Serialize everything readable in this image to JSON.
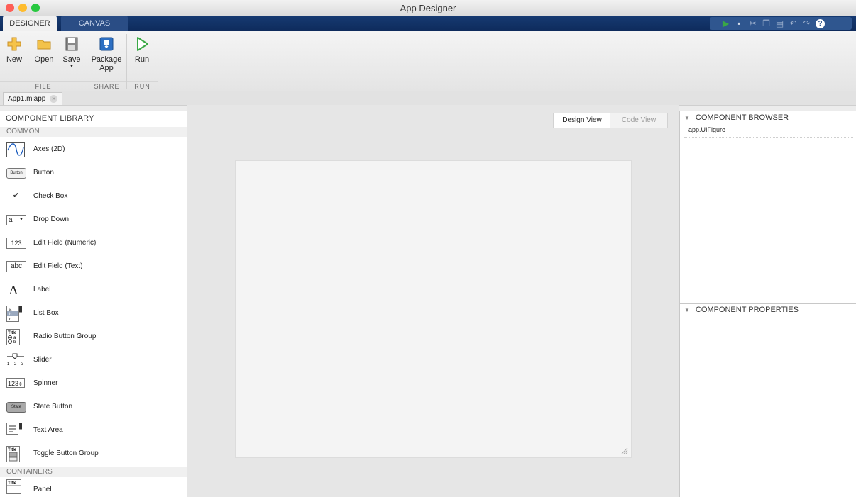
{
  "window": {
    "title": "App Designer"
  },
  "tabs": [
    {
      "label": "DESIGNER"
    },
    {
      "label": "CANVAS"
    }
  ],
  "ribbon": {
    "file": {
      "new": "New",
      "open": "Open",
      "save": "Save",
      "section": "FILE"
    },
    "share": {
      "package": "Package App",
      "section": "SHARE"
    },
    "run": {
      "run": "Run",
      "section": "RUN"
    }
  },
  "document": {
    "tab": "App1.mlapp"
  },
  "library": {
    "header": "COMPONENT LIBRARY",
    "common_label": "COMMON",
    "items": [
      {
        "label": "Axes (2D)",
        "icon": "axes-icon"
      },
      {
        "label": "Button",
        "icon": "button-icon"
      },
      {
        "label": "Check Box",
        "icon": "checkbox-icon"
      },
      {
        "label": "Drop Down",
        "icon": "dropdown-icon"
      },
      {
        "label": "Edit Field (Numeric)",
        "icon": "numeric-field-icon"
      },
      {
        "label": "Edit Field (Text)",
        "icon": "text-field-icon"
      },
      {
        "label": "Label",
        "icon": "label-icon"
      },
      {
        "label": "List Box",
        "icon": "listbox-icon"
      },
      {
        "label": "Radio Button Group",
        "icon": "radio-group-icon"
      },
      {
        "label": "Slider",
        "icon": "slider-icon"
      },
      {
        "label": "Spinner",
        "icon": "spinner-icon"
      },
      {
        "label": "State Button",
        "icon": "state-button-icon"
      },
      {
        "label": "Text Area",
        "icon": "text-area-icon"
      },
      {
        "label": "Toggle Button Group",
        "icon": "toggle-group-icon"
      }
    ],
    "containers_label": "CONTAINERS",
    "containers": [
      {
        "label": "Panel",
        "icon": "panel-icon"
      }
    ],
    "icon_text": {
      "button": "Button",
      "dropdown": "a",
      "numeric": "123",
      "text": "abc",
      "label": "A",
      "title": "Title",
      "state": "State",
      "spinner": "123"
    }
  },
  "canvas": {
    "design_view": "Design View",
    "code_view": "Code View"
  },
  "browser": {
    "header": "COMPONENT BROWSER",
    "items": [
      {
        "label": "app.UIFigure"
      }
    ]
  },
  "properties": {
    "header": "COMPONENT PROPERTIES"
  },
  "colors": {
    "accent": "#163a72",
    "run": "#3aa845",
    "close": "#fe5f57",
    "minimize": "#febc2e",
    "zoom": "#28c840"
  }
}
